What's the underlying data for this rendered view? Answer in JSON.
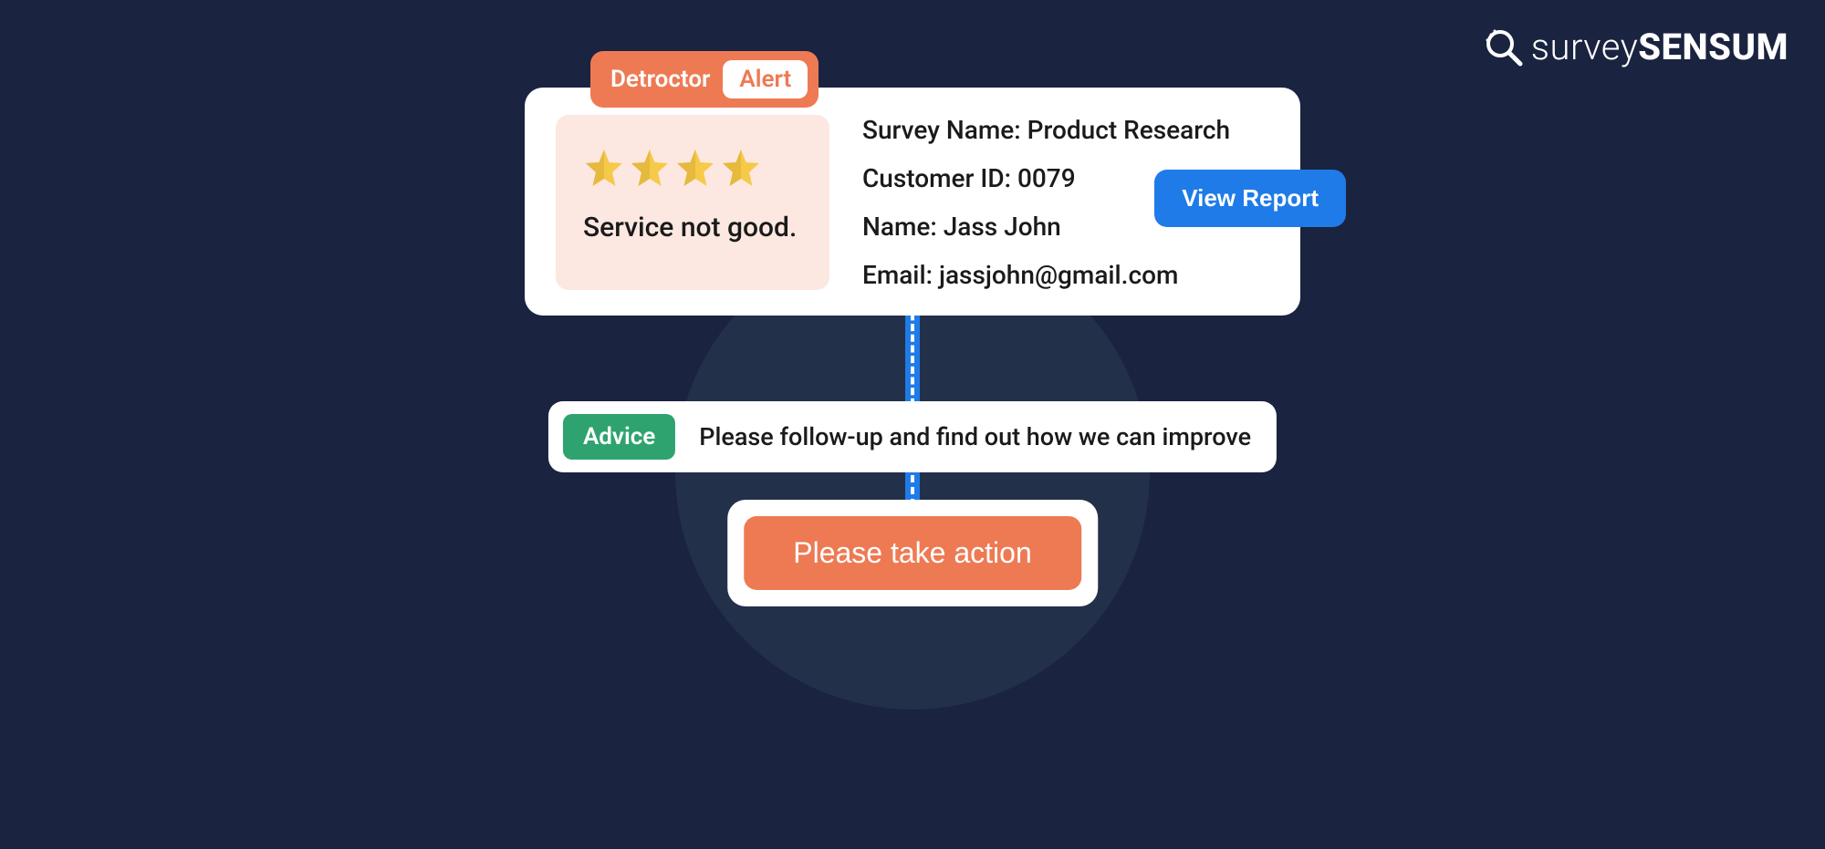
{
  "brand": {
    "name_thin": "survey",
    "name_bold": "SENSUM"
  },
  "colors": {
    "bg": "#1a2340",
    "bg_circle": "#23304a",
    "accent_orange": "#ee7a54",
    "accent_blue": "#1f7be8",
    "accent_green": "#2fa36f",
    "rating_bg": "#fce8e1",
    "star_fill": "#f7c948",
    "star_shadow": "#e6b93f"
  },
  "badge": {
    "primary": "Detroctor",
    "secondary": "Alert"
  },
  "rating": {
    "stars_count": 4,
    "comment": "Service not good."
  },
  "details": {
    "survey_label": "Survey Name:",
    "survey_value": "Product Research",
    "customer_label": "Customer ID:",
    "customer_value": "0079",
    "name_label": "Name:",
    "name_value": "Jass John",
    "email_label": "Email:",
    "email_value": "jassjohn@gmail.com"
  },
  "buttons": {
    "view_report": "View Report",
    "action": "Please take action"
  },
  "advice": {
    "badge": "Advice",
    "text": "Please follow-up and find out how we can improve"
  }
}
